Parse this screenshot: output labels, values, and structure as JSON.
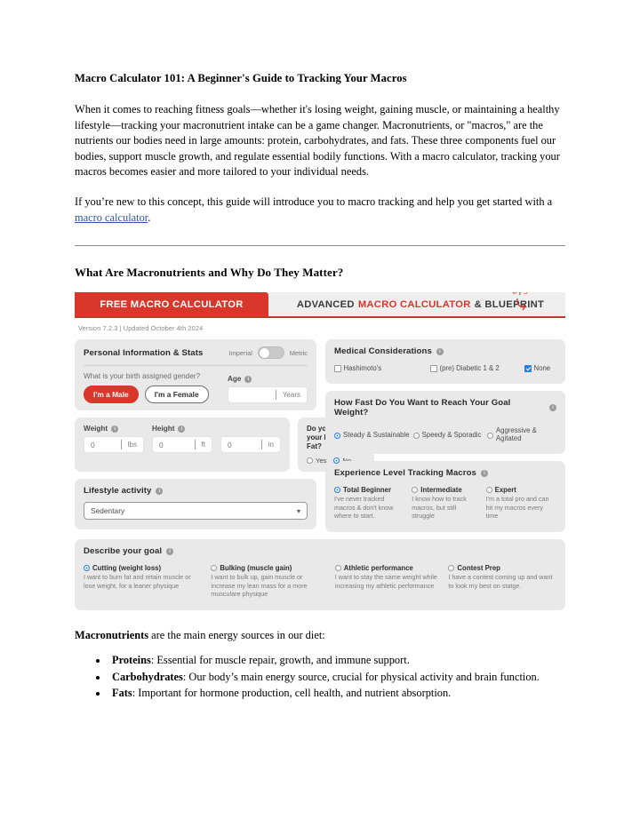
{
  "article": {
    "title": "Macro Calculator 101: A Beginner's Guide to Tracking Your Macros",
    "para1": "When it comes to reaching fitness goals—whether it's losing weight, gaining muscle, or maintaining a healthy lifestyle—tracking your macronutrient intake can be a game changer. Macronutrients, or \"macros,\" are the nutrients our bodies need in large amounts: protein, carbohydrates, and fats. These three components fuel our bodies, support muscle growth, and regulate essential bodily functions. With a macro calculator, tracking your macros becomes easier and more tailored to your individual needs.",
    "para2_before": "If you’re new to this concept, this guide will introduce you to macro tracking and help you get started with a ",
    "para2_link": "macro calculator",
    "para2_after": ".",
    "section_heading": "What Are Macronutrients and Why Do They Matter?",
    "closing_lead_bold": "Macronutrients",
    "closing_lead_rest": " are the main energy sources in our diet:",
    "bullets": [
      {
        "term": "Proteins",
        "text": ": Essential for muscle repair, growth, and immune support."
      },
      {
        "term": "Carbohydrates",
        "text": ": Our body’s main energy source, crucial for physical activity and brain function."
      },
      {
        "term": "Fats",
        "text": ": Important for hormone production, cell health, and nutrient absorption."
      }
    ]
  },
  "calculator": {
    "tabs": {
      "free": "FREE MACRO CALCULATOR",
      "advanced_part1": "ADVANCED ",
      "advanced_highlight": "MACRO CALCULATOR",
      "advanced_part2": " & BLUEPRINT",
      "upgrade_note": "Upgrade"
    },
    "version_line": "Version 7.2.3 | Updated October 4th 2024",
    "personal_info": {
      "title": "Personal Information & Stats",
      "unit_imperial": "Imperial",
      "unit_metric": "Metric",
      "unit_selected": "Imperial",
      "gender_question": "What is your birth assigned gender?",
      "male_label": "I'm a Male",
      "female_label": "I'm a Female",
      "gender_selected": "I'm a Male",
      "age_label": "Age",
      "age_value": "",
      "age_suffix": "Years"
    },
    "measurements": {
      "weight_label": "Weight",
      "weight_value": "0",
      "weight_unit": "lbs",
      "height_label": "Height",
      "height_ft_value": "0",
      "height_ft_unit": "ft",
      "height_in_value": "0",
      "height_in_unit": "in"
    },
    "body_fat": {
      "title": "Do you know your Body Fat?",
      "yes_label": "Yes",
      "no_label": "No",
      "selected": "No"
    },
    "lifestyle": {
      "title": "Lifestyle activity",
      "selected": "Sedentary"
    },
    "medical": {
      "title": "Medical Considerations",
      "options": [
        {
          "label": "Hashimoto's",
          "checked": false
        },
        {
          "label": "(pre) Diabetic 1 & 2",
          "checked": false
        },
        {
          "label": "None",
          "checked": true
        }
      ]
    },
    "goal_speed": {
      "title": "How Fast Do You Want to Reach Your Goal Weight?",
      "options": [
        {
          "label": "Steady & Sustainable",
          "selected": true
        },
        {
          "label": "Speedy & Sporadic",
          "selected": false
        },
        {
          "label": "Aggressive & Agitated",
          "selected": false
        }
      ]
    },
    "experience": {
      "title": "Experience Level Tracking Macros",
      "options": [
        {
          "label": "Total Beginner",
          "desc": "I've never tracked macros & don't know where to start.",
          "selected": true
        },
        {
          "label": "Intermediate",
          "desc": "I know how to track macros, but still struggle",
          "selected": false
        },
        {
          "label": "Expert",
          "desc": "I'm a total pro and can hit my macros every time",
          "selected": false
        }
      ]
    },
    "goal": {
      "title": "Describe your goal",
      "options": [
        {
          "label": "Cutting (weight loss)",
          "desc": "I want to burn fat and retain muscle or lose weight, for a leaner physique",
          "selected": true
        },
        {
          "label": "Bulking (muscle gain)",
          "desc": "I want to bulk up, gain muscle or increase my lean mass for a more musculare physique",
          "selected": false
        },
        {
          "label": "Athletic performance",
          "desc": "I want to stay the same weight while increasing my athletic performance",
          "selected": false
        },
        {
          "label": "Contest Prep",
          "desc": "I have a contest coming up and want to look my best on statge.",
          "selected": false
        }
      ]
    },
    "colors": {
      "brand_red": "#d9372b",
      "tab_border_red": "#c0392b",
      "card_grey": "#e9e9ea",
      "radio_blue": "#2b7fe0",
      "link_blue": "#2c55a8"
    }
  }
}
